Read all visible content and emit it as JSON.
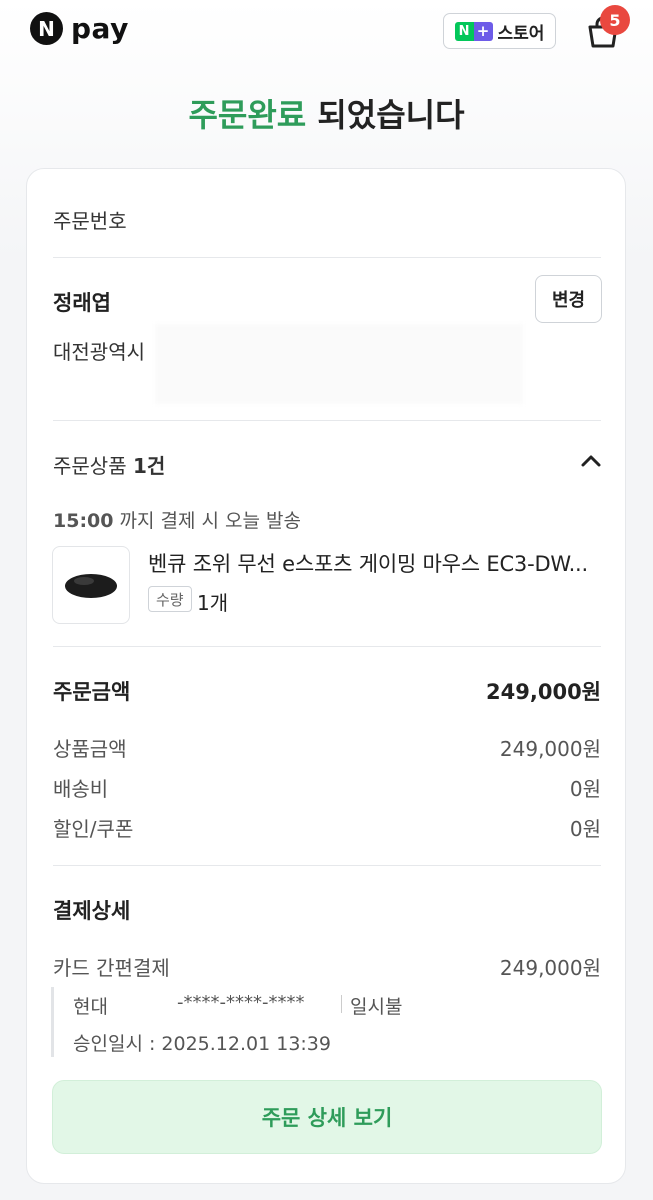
{
  "header": {
    "logo_mark": "N",
    "logo_text": "pay",
    "store_n": "N",
    "store_plus": "+",
    "store_label": "스토어",
    "cart_count": "5"
  },
  "title": {
    "highlight": "주문완료",
    "rest": " 되었습니다"
  },
  "order": {
    "number_label": "주문번호"
  },
  "shipping": {
    "recipient": "정래엽",
    "address": "대전광역시",
    "change_label": "변경"
  },
  "products": {
    "section_label": "주문상품 ",
    "section_count": "1건",
    "dispatch_time": "15:00",
    "dispatch_text": " 까지 결제 시 오늘 발송",
    "items": [
      {
        "name": "벤큐 조위 무선 e스포츠 게이밍 마우스 EC3-DW...",
        "qty_label": "수량",
        "qty": "1개"
      }
    ]
  },
  "amounts": {
    "total_label": "주문금액",
    "total_value": "249,000원",
    "rows": [
      {
        "label": "상품금액",
        "value": "249,000원"
      },
      {
        "label": "배송비",
        "value": "0원"
      },
      {
        "label": "할인/쿠폰",
        "value": "0원"
      }
    ]
  },
  "payment": {
    "section_label": "결제상세",
    "method_label": "카드 간편결제",
    "method_value": "249,000원",
    "card_issuer": "현대",
    "card_number": "-****-****-****",
    "installment": "일시불",
    "approved_at": "승인일시 : 2025.12.01 13:39"
  },
  "cta": {
    "label": "주문 상세 보기"
  },
  "colors": {
    "accent_green": "#2e9c5a",
    "naver_green": "#03c75a",
    "plus_purple": "#6d5ce8",
    "badge_red": "#e9483f",
    "cta_bg": "#e2f7e7"
  }
}
